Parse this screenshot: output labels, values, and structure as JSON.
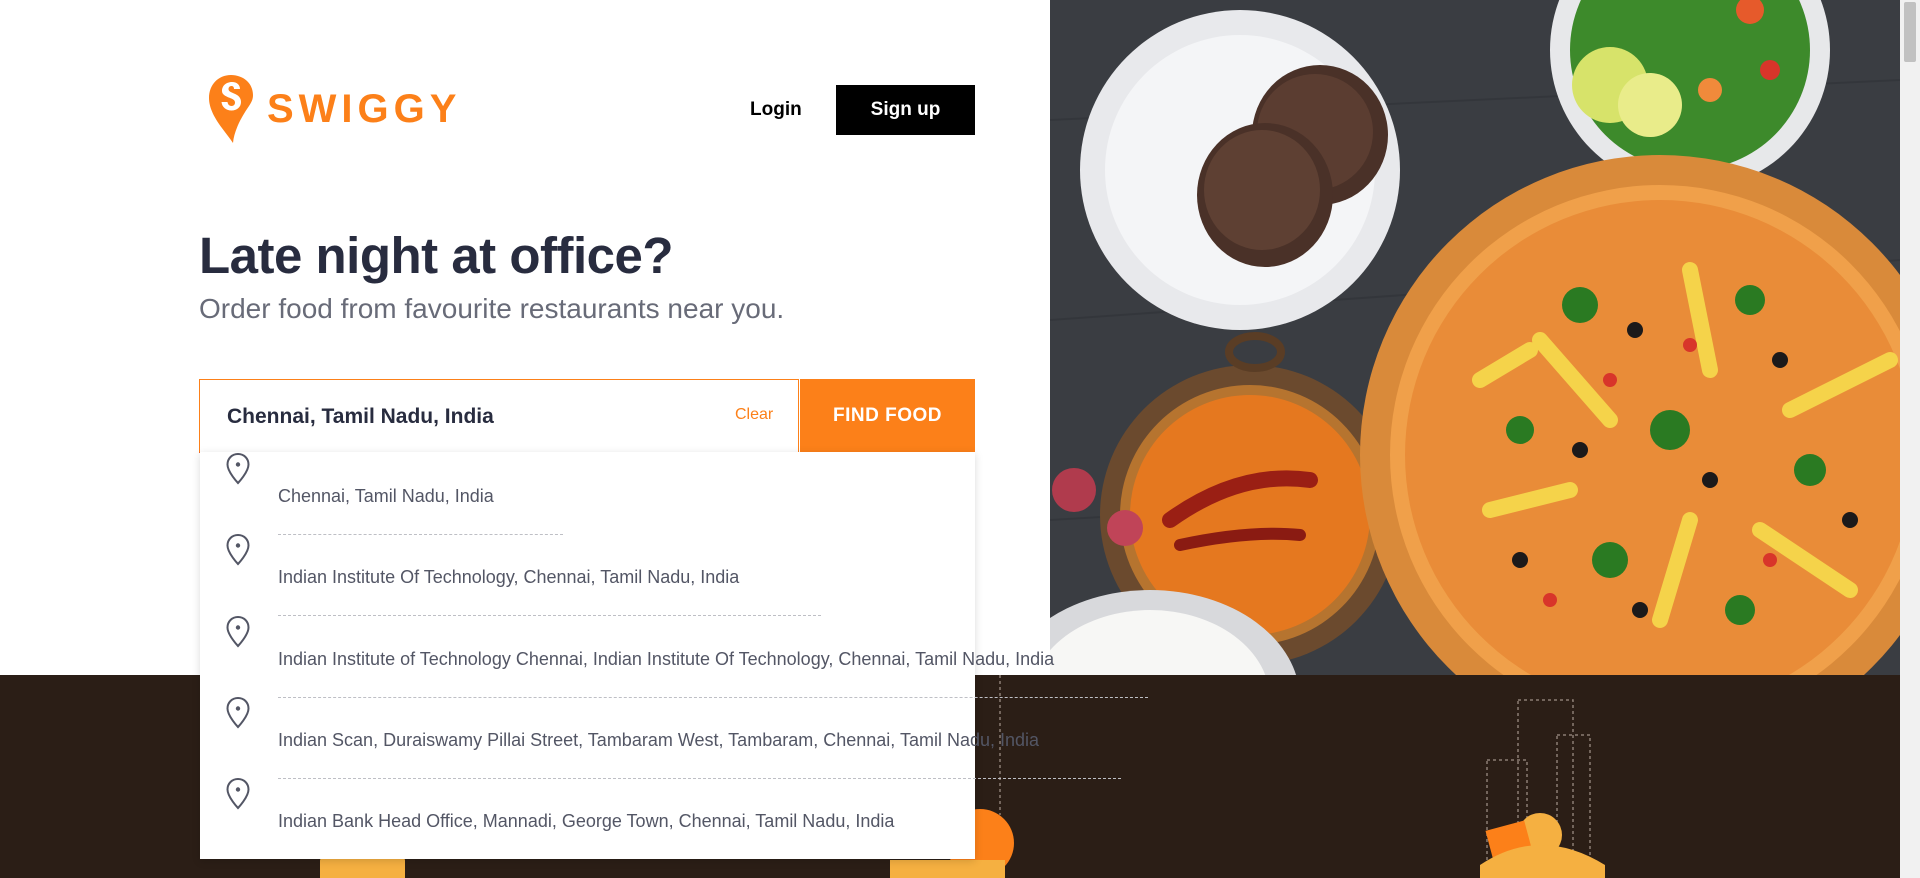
{
  "header": {
    "brand": "SWIGGY",
    "login_label": "Login",
    "signup_label": "Sign up"
  },
  "hero": {
    "headline": "Late night at office?",
    "subline": "Order food from favourite restaurants near you."
  },
  "search": {
    "value": "Chennai, Tamil Nadu, India",
    "clear_label": "Clear",
    "find_label": "FIND FOOD"
  },
  "suggestions": [
    "Chennai, Tamil Nadu, India",
    "Indian Institute Of Technology, Chennai, Tamil Nadu, India",
    "Indian Institute of Technology Chennai, Indian Institute Of Technology, Chennai, Tamil Nadu, India",
    "Indian Scan, Duraiswamy Pillai Street, Tambaram West, Tambaram, Chennai, Tamil Nadu, India",
    "Indian Bank Head Office, Mannadi, George Town, Chennai, Tamil Nadu, India"
  ],
  "colors": {
    "brand_orange": "#fc8019",
    "dark_strip": "#2b1e16",
    "text_dark": "#282c3f",
    "text_muted": "#686b78"
  },
  "icons": {
    "logo": "swiggy-pin-logo-icon",
    "suggestion": "location-pin-icon"
  }
}
